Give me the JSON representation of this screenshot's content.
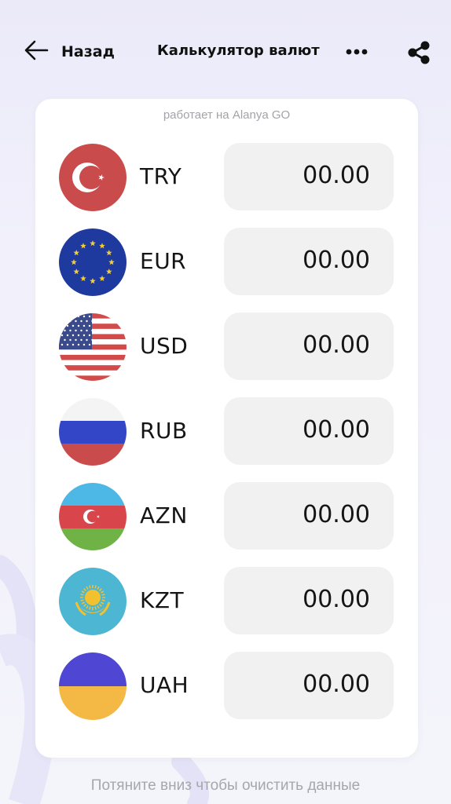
{
  "header": {
    "back_label": "Назад",
    "title": "Калькулятор валют",
    "icons": [
      "arrow-left-icon",
      "more-dots-icon",
      "share-icon"
    ]
  },
  "card": {
    "powered_by": "работает на Alanya GO",
    "rows": [
      {
        "code": "TRY",
        "value": "00.00",
        "flag": "turkey-flag-icon"
      },
      {
        "code": "EUR",
        "value": "00.00",
        "flag": "eu-flag-icon"
      },
      {
        "code": "USD",
        "value": "00.00",
        "flag": "usa-flag-icon"
      },
      {
        "code": "RUB",
        "value": "00.00",
        "flag": "russia-flag-icon"
      },
      {
        "code": "AZN",
        "value": "00.00",
        "flag": "azerbaijan-flag-icon"
      },
      {
        "code": "KZT",
        "value": "00.00",
        "flag": "kazakhstan-flag-icon"
      },
      {
        "code": "UAH",
        "value": "00.00",
        "flag": "ukraine-flag-icon"
      }
    ]
  },
  "footer": {
    "hint": "Потяните вниз чтобы очистить данные"
  },
  "colors": {
    "background": "#efeefa",
    "card": "#ffffff",
    "input_bg": "#f1f1f2",
    "muted_text": "#a3a3a8"
  }
}
